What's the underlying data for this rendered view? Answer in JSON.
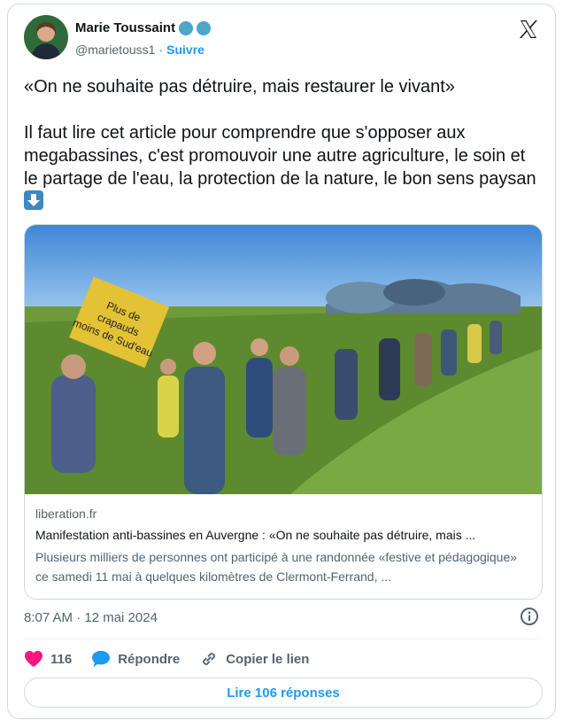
{
  "author": {
    "name": "Marie Toussaint",
    "handle": "@marietouss1",
    "separator": "·",
    "follow_label": "Suivre"
  },
  "tweet": {
    "quote_line": "«On ne souhaite pas détruire, mais restaurer le vivant»",
    "body": "Il faut lire cet article pour comprendre que s'opposer aux megabassines, c'est promouvoir une autre agriculture, le soin et le partage de l'eau, la protection de la nature, le bon sens paysan"
  },
  "link_card": {
    "domain": "liberation.fr",
    "title": "Manifestation anti-bassines en Auvergne : «On ne souhaite pas détruire, mais ...",
    "description": "Plusieurs milliers de personnes ont participé à une randonnée «festive et pédagogique» ce samedi 11 mai à quelques kilomètres de Clermont-Ferrand, ...",
    "sign_text": "Plus de crapauds moins de Sud'eau"
  },
  "meta": {
    "timestamp": "8:07 AM · 12 mai 2024"
  },
  "actions": {
    "like_count": "116",
    "reply_label": "Répondre",
    "copy_label": "Copier le lien"
  },
  "read_replies_label": "Lire 106 réponses",
  "colors": {
    "accent": "#1d9bf0",
    "like": "#f91880",
    "text": "#0f1419",
    "muted": "#536471"
  },
  "icons": [
    "globe-icon",
    "x-logo-icon",
    "down-arrow-emoji",
    "info-icon",
    "heart-icon",
    "reply-bubble-icon",
    "link-icon"
  ]
}
